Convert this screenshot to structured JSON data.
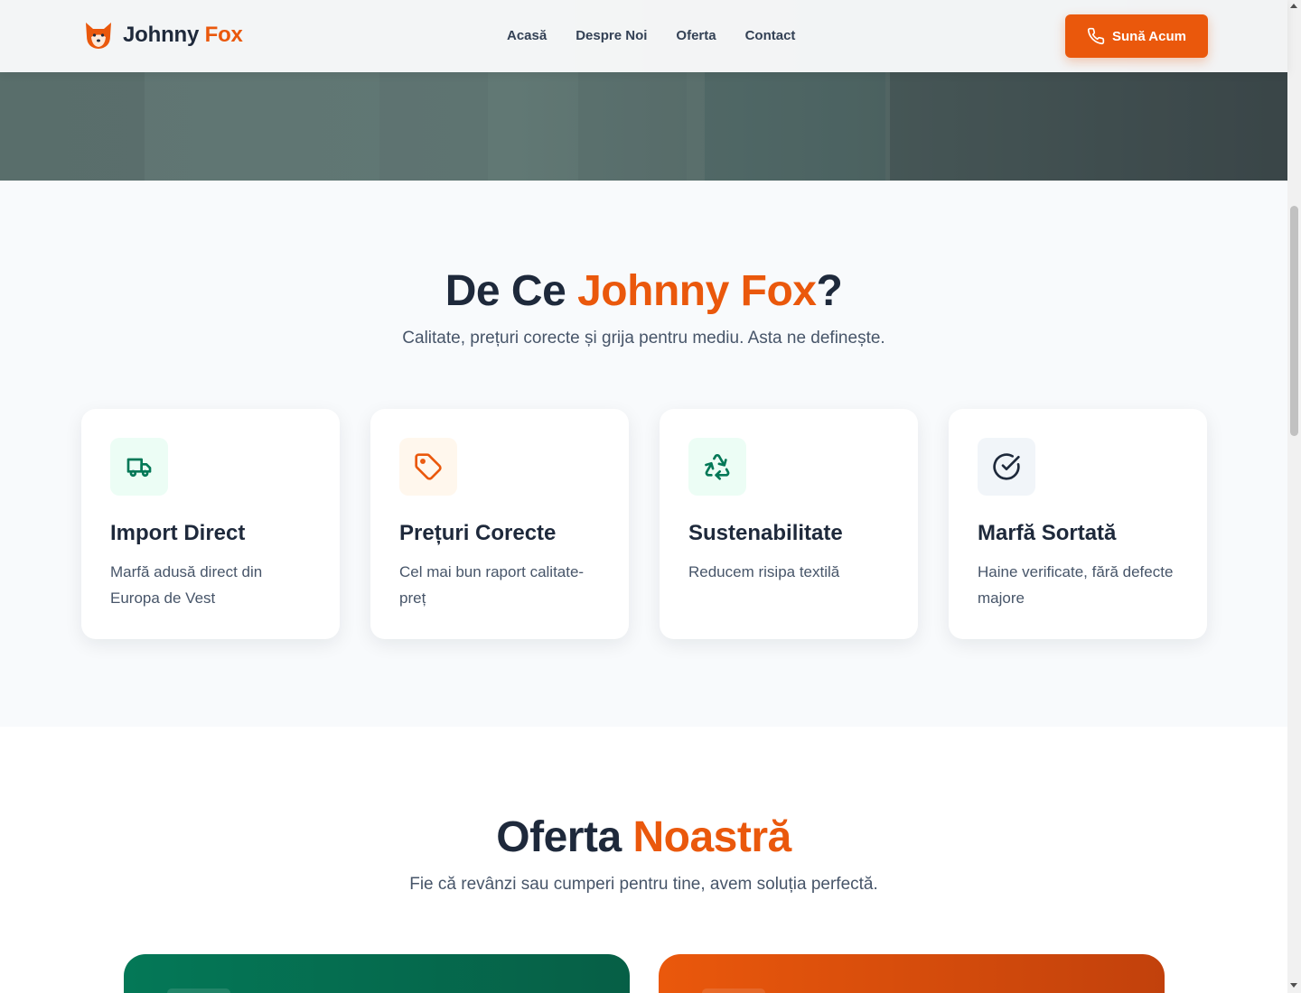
{
  "header": {
    "logo_part1": "Johnny",
    "logo_part2": "Fox",
    "logo_icon": "fox-icon",
    "nav": [
      {
        "label": "Acasă"
      },
      {
        "label": "Despre Noi"
      },
      {
        "label": "Oferta"
      },
      {
        "label": "Contact"
      }
    ],
    "cta_label": "Sună Acum",
    "cta_icon": "phone-icon"
  },
  "why": {
    "title_part1": "De Ce",
    "title_accent": "Johnny Fox",
    "title_end": "?",
    "subtitle": "Calitate, prețuri corecte și grija pentru mediu. Asta ne definește.",
    "cards": [
      {
        "icon": "truck-icon",
        "title": "Import Direct",
        "text": "Marfă adusă direct din Europa de Vest"
      },
      {
        "icon": "tag-icon",
        "title": "Prețuri Corecte",
        "text": "Cel mai bun raport calitate-preț"
      },
      {
        "icon": "recycle-icon",
        "title": "Sustenabilitate",
        "text": "Reducem risipa textilă"
      },
      {
        "icon": "check-circle-icon",
        "title": "Marfă Sortată",
        "text": "Haine verificate, fără defecte majore"
      }
    ]
  },
  "offer": {
    "title_part1": "Oferta",
    "title_accent": "Noastră",
    "subtitle": "Fie că revânzi sau cumperi pentru tine, avem soluția perfectă."
  },
  "colors": {
    "accent": "#ea580c",
    "green": "#047857",
    "dark": "#1e293b"
  }
}
